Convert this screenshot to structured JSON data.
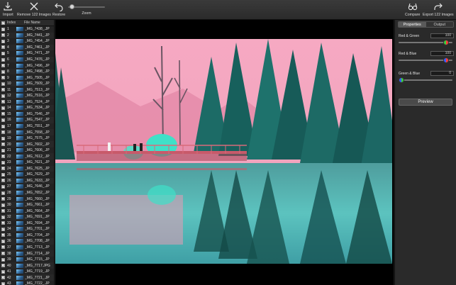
{
  "toolbar": {
    "import_label": "Import",
    "remove_label": "Remove 122 Images",
    "restore_label": "Restore",
    "zoom_label": "Zoom",
    "compare_label": "Compare",
    "export_label": "Export 122 Images",
    "zoom_level": 0.05
  },
  "list": {
    "header_index": "Index",
    "header_filename": "File Name",
    "rows": [
      {
        "index": "1",
        "name": "_MG_7438_.JP"
      },
      {
        "index": "2",
        "name": "_MG_7441_.JP"
      },
      {
        "index": "3",
        "name": "_MG_7454_.JP"
      },
      {
        "index": "4",
        "name": "_MG_7461_.JP"
      },
      {
        "index": "5",
        "name": "_MG_7471_.JP"
      },
      {
        "index": "6",
        "name": "_MG_7476_.JP"
      },
      {
        "index": "7",
        "name": "_MG_7496_.JP"
      },
      {
        "index": "8",
        "name": "_MG_7498_.JP"
      },
      {
        "index": "9",
        "name": "_MG_7505_.JP"
      },
      {
        "index": "10",
        "name": "_MG_7509_.JP"
      },
      {
        "index": "11",
        "name": "_MG_7513_.JP"
      },
      {
        "index": "12",
        "name": "_MG_7516_.JP"
      },
      {
        "index": "13",
        "name": "_MG_7524_.JP"
      },
      {
        "index": "14",
        "name": "_MG_7534_.JP"
      },
      {
        "index": "15",
        "name": "_MG_7546_.JP"
      },
      {
        "index": "16",
        "name": "_MG_7547_.JP"
      },
      {
        "index": "17",
        "name": "_MG_7551_.JP"
      },
      {
        "index": "18",
        "name": "_MG_7558_.JP"
      },
      {
        "index": "19",
        "name": "_MG_7575_.JP"
      },
      {
        "index": "20",
        "name": "_MG_7602_.JP"
      },
      {
        "index": "21",
        "name": "_MG_7606_.JP"
      },
      {
        "index": "22",
        "name": "_MG_7612_.JP"
      },
      {
        "index": "23",
        "name": "_MG_7621_.JP"
      },
      {
        "index": "24",
        "name": "_MG_7625_.JP"
      },
      {
        "index": "25",
        "name": "_MG_7629_.JP"
      },
      {
        "index": "26",
        "name": "_MG_7633_.JP"
      },
      {
        "index": "27",
        "name": "_MG_7646_.JP"
      },
      {
        "index": "28",
        "name": "_MG_7652_.JP"
      },
      {
        "index": "29",
        "name": "_MG_7660_.JP"
      },
      {
        "index": "30",
        "name": "_MG_7661_.JP"
      },
      {
        "index": "31",
        "name": "_MG_7664_.JP"
      },
      {
        "index": "32",
        "name": "_MG_7691_.JP"
      },
      {
        "index": "33",
        "name": "_MG_7694_.JP"
      },
      {
        "index": "34",
        "name": "_MG_7701_.JP"
      },
      {
        "index": "35",
        "name": "_MG_7704_.JP"
      },
      {
        "index": "36",
        "name": "_MG_7708_.JP"
      },
      {
        "index": "37",
        "name": "_MG_7713_.JP"
      },
      {
        "index": "38",
        "name": "_MG_7714_.JP"
      },
      {
        "index": "39",
        "name": "_MG_7715_.JP"
      },
      {
        "index": "40",
        "name": "_MG_7717.JPG"
      },
      {
        "index": "41",
        "name": "_MG_7719_.JP"
      },
      {
        "index": "42",
        "name": "_MG_7721_.JP"
      },
      {
        "index": "43",
        "name": "_MG_7722_.JP"
      }
    ]
  },
  "panel": {
    "tab_properties": "Properties",
    "tab_output": "Output",
    "controls": [
      {
        "label": "Red & Green",
        "value": "100",
        "level": 0.92
      },
      {
        "label": "Red & Blue",
        "value": "100",
        "level": 0.92
      },
      {
        "label": "Green & Blue",
        "value": "0",
        "level": 0.0
      }
    ],
    "preview_label": "Preview"
  },
  "colors": {
    "sky": "#f3a7c0",
    "trees": "#1f6f68",
    "water": "#4fb4b4",
    "bridge": "#c85a6a"
  }
}
